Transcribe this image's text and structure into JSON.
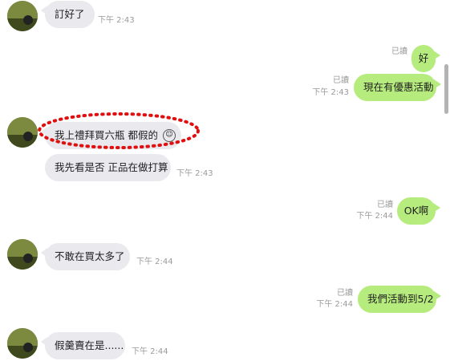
{
  "chat": {
    "messages": [
      {
        "type": "in",
        "text": "訂好了",
        "time": "下午 2:43"
      },
      {
        "type": "out",
        "text": "好",
        "read": "已讀"
      },
      {
        "type": "out",
        "text": "現在有優惠活動",
        "read": "已讀",
        "time": "下午 2:43"
      },
      {
        "type": "in",
        "text": "我上禮拜買六瓶 都假的",
        "icon": "sticker-face-icon"
      },
      {
        "type": "in",
        "text": "我先看是否 正品在做打算",
        "time": "下午 2:43"
      },
      {
        "type": "out",
        "text": "OK啊",
        "read": "已讀",
        "time": "下午 2:44"
      },
      {
        "type": "in",
        "text": "不敢在買太多了",
        "time": "下午 2:44"
      },
      {
        "type": "out",
        "text": "我們活動到5/2",
        "read": "已讀",
        "time": "下午 2:44"
      },
      {
        "type": "in",
        "text": "假羹賣在是......",
        "time": "下午 2:44"
      }
    ]
  },
  "colors": {
    "incoming_bubble": "#e9e9ee",
    "outgoing_bubble": "#b6ec7d",
    "highlight_ring": "#e01010",
    "meta_text": "#9a9a9a"
  }
}
